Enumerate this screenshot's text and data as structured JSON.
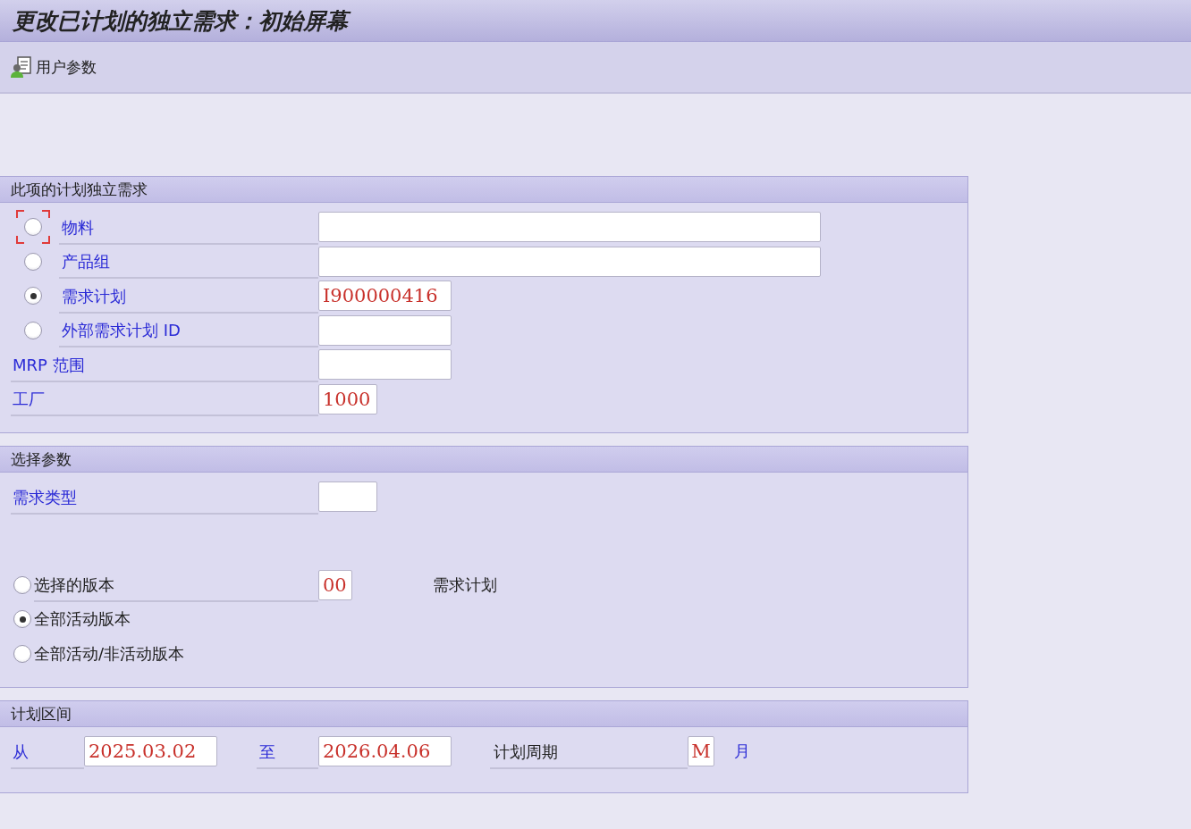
{
  "window": {
    "title": "更改已计划的独立需求：初始屏幕"
  },
  "toolbar": [
    {
      "label": "用户参数"
    }
  ],
  "groups": [
    {
      "title": "此项的计划独立需求",
      "rows": [
        {
          "kind": "radio-field",
          "label": "物料",
          "selected": false,
          "focused": true,
          "field": {
            "kind": "wide"
          }
        },
        {
          "kind": "radio-field",
          "label": "产品组",
          "selected": false,
          "focused": false,
          "field": {
            "kind": "wide"
          }
        },
        {
          "kind": "radio-field",
          "label": "需求计划",
          "selected": true,
          "focused": false,
          "field": {
            "value": "I900000416",
            "kind": "medium"
          }
        },
        {
          "kind": "radio-field",
          "label": "外部需求计划 ID",
          "selected": false,
          "focused": false,
          "field": {
            "kind": "medium"
          }
        },
        {
          "kind": "field",
          "label": "MRP 范围",
          "field": {
            "kind": "medium"
          }
        },
        {
          "kind": "field",
          "label": "工厂",
          "field": {
            "value": "1000",
            "kind": "short"
          }
        }
      ]
    },
    {
      "title": "选择参数",
      "rows": [
        {
          "kind": "field",
          "label": "需求类型",
          "field": {
            "kind": "short"
          }
        },
        {
          "kind": "spacer"
        },
        {
          "kind": "radio",
          "label": "选择的版本",
          "selected": false,
          "focused": false,
          "field": {
            "value": "00",
            "kind": "tiny"
          },
          "note": "需求计划"
        },
        {
          "kind": "radio",
          "label": "全部活动版本",
          "selected": true,
          "focused": false
        },
        {
          "kind": "radio",
          "label": "全部活动/非活动版本",
          "selected": false,
          "focused": false
        }
      ]
    },
    {
      "title": "计划区间",
      "period": {
        "from_label": "从",
        "from": "2025.03.02",
        "to_label": "至",
        "to": "2026.04.06",
        "period_label": "计划周期",
        "period": "M",
        "period_text": "月"
      }
    }
  ]
}
